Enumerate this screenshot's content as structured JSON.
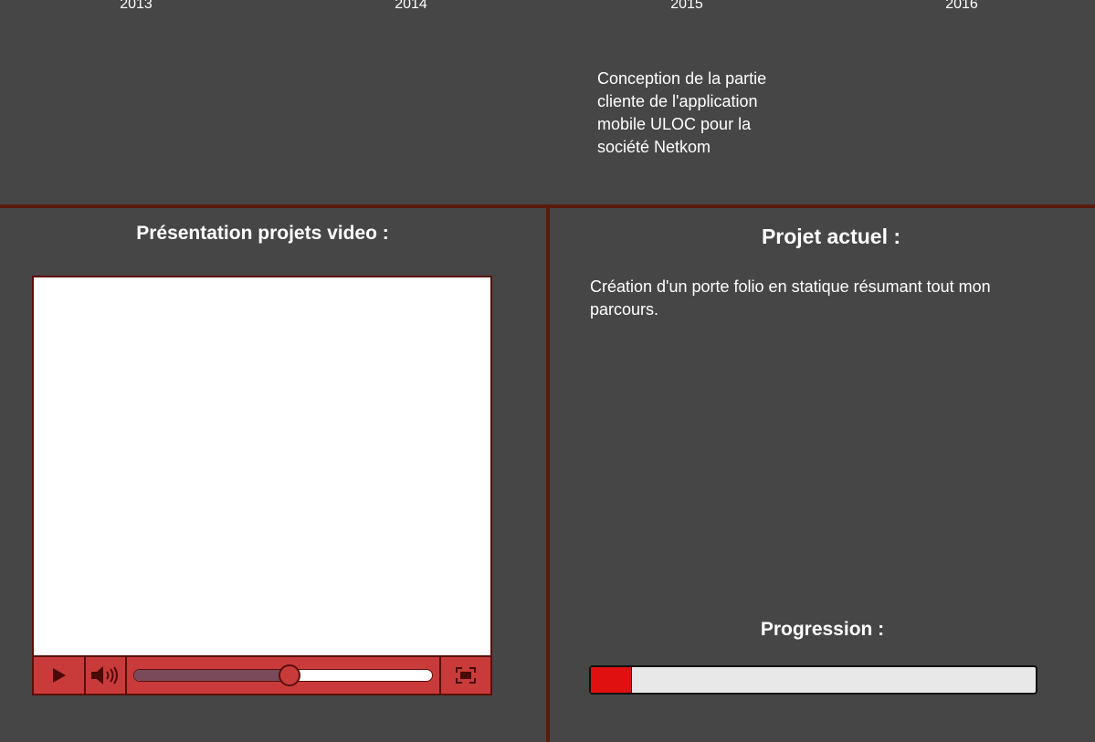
{
  "timeline": {
    "years": [
      "2013",
      "2014",
      "2015",
      "2016"
    ],
    "event_text": "Conception de la partie cliente de l'application mobile ULOC pour la société Netkom"
  },
  "video_section": {
    "title": "Présentation projets video :",
    "player": {
      "progress_fraction": 0.52,
      "icons": [
        "play-icon",
        "volume-icon",
        "fullscreen-icon"
      ]
    }
  },
  "current_project": {
    "title": "Projet actuel :",
    "description": "Création d'un porte folio en statique résumant tout mon parcours.",
    "progress_title": "Progression :",
    "progress_fraction": 0.09
  },
  "colors": {
    "background": "#464646",
    "divider": "#5a1b0c",
    "controls": "#c93b3b",
    "progress_fill": "#e01010"
  }
}
